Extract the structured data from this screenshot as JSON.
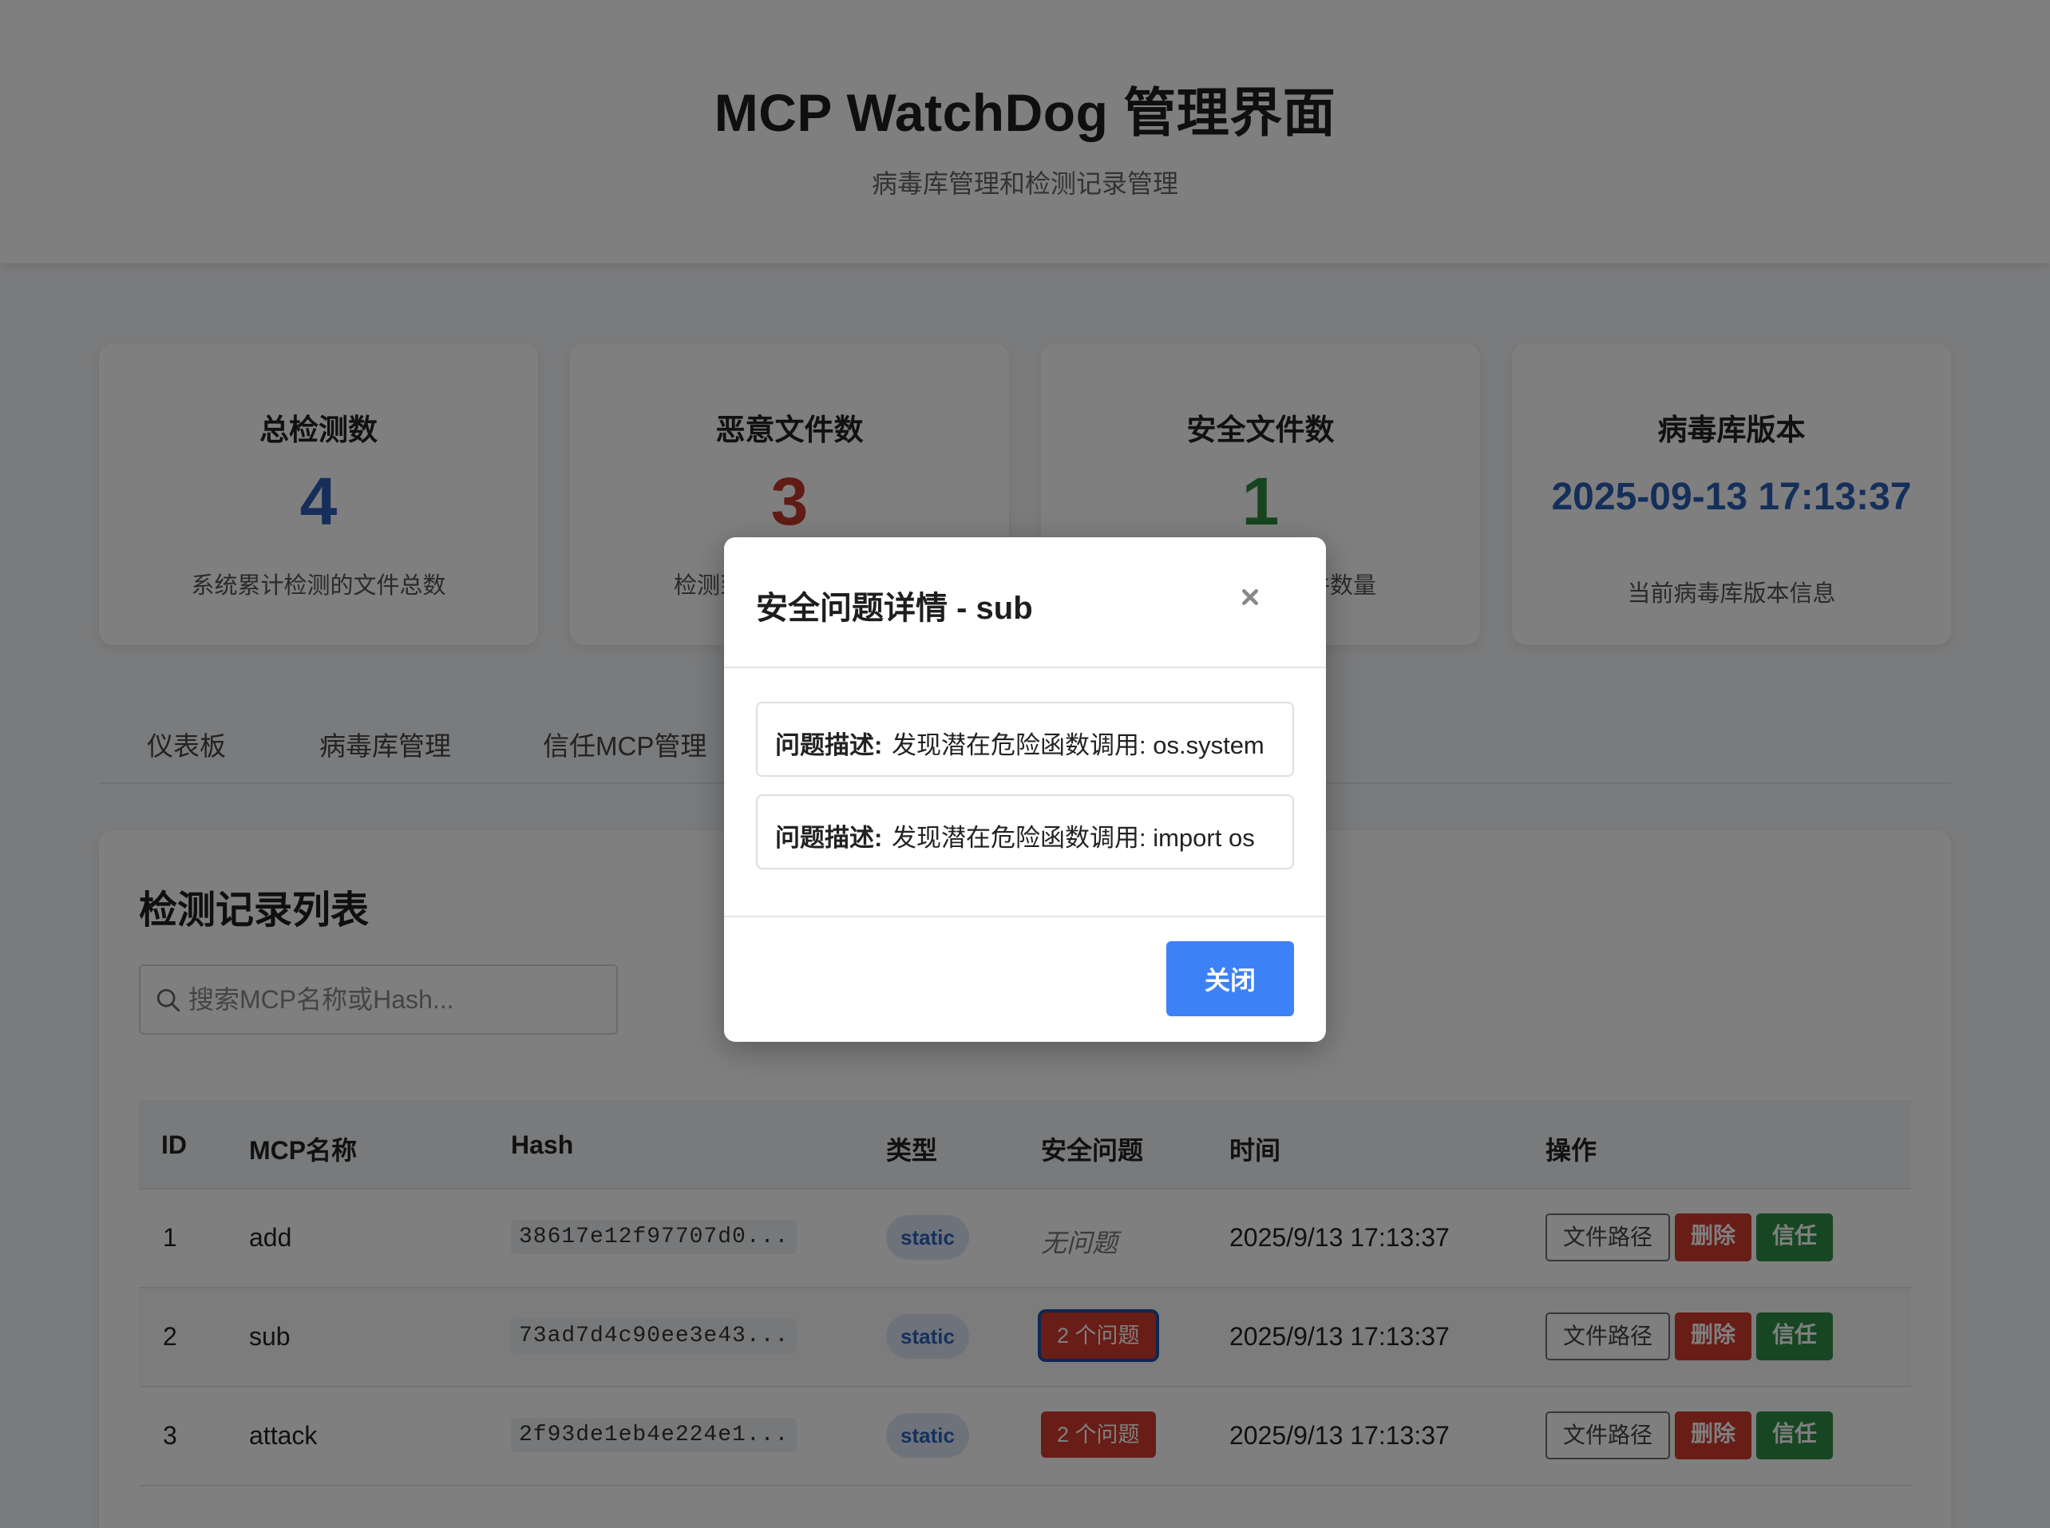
{
  "header": {
    "title": "MCP WatchDog 管理界面",
    "subtitle": "病毒库管理和检测记录管理"
  },
  "stats": [
    {
      "title": "总检测数",
      "value": "4",
      "desc": "系统累计检测的文件总数",
      "color": "#2b5fb4"
    },
    {
      "title": "恶意文件数",
      "value": "3",
      "desc": "检测到的恶意文件数量",
      "color": "#c0392b"
    },
    {
      "title": "安全文件数",
      "value": "1",
      "desc": "检测为安全的文件数量",
      "color": "#2e8b3e"
    },
    {
      "title": "病毒库版本",
      "value": "2025-09-13 17:13:37",
      "desc": "当前病毒库版本信息",
      "color": "#2b5fb4"
    }
  ],
  "tabs": [
    "仪表板",
    "病毒库管理",
    "信任MCP管理"
  ],
  "records": {
    "title": "检测记录列表",
    "search_placeholder": "搜索MCP名称或Hash...",
    "columns": [
      "ID",
      "MCP名称",
      "Hash",
      "类型",
      "安全问题",
      "时间",
      "操作"
    ],
    "rows": [
      {
        "id": "1",
        "name": "add",
        "hash": "38617e12f97707d0...",
        "type": "static",
        "issue": "无问题",
        "time": "2025/9/13 17:13:37"
      },
      {
        "id": "2",
        "name": "sub",
        "hash": "73ad7d4c90ee3e43...",
        "type": "static",
        "issue": "2 个问题",
        "time": "2025/9/13 17:13:37"
      },
      {
        "id": "3",
        "name": "attack",
        "hash": "2f93de1eb4e224e1...",
        "type": "static",
        "issue": "2 个问题",
        "time": "2025/9/13 17:13:37"
      }
    ],
    "actions": {
      "path": "文件路径",
      "delete": "删除",
      "trust": "信任"
    }
  },
  "modal": {
    "title": "安全问题详情 - sub",
    "issue_label": "问题描述:",
    "issues": [
      "发现潜在危险函数调用: os.system",
      "发现潜在危险函数调用: import os"
    ],
    "close_label": "关闭"
  },
  "icons": {
    "search": "search-icon",
    "close": "close-icon"
  }
}
